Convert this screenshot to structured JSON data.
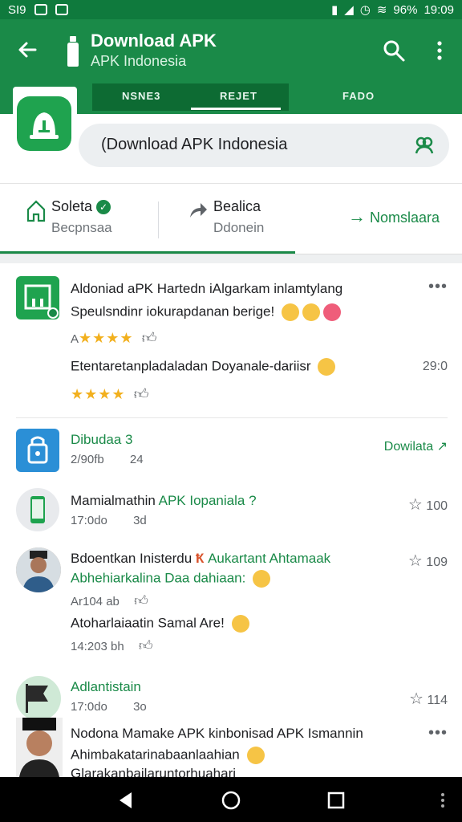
{
  "status": {
    "left_text": "SI9",
    "battery": "96%",
    "time": "19:09"
  },
  "header": {
    "title": "Download APK",
    "subtitle": "APK Indonesia"
  },
  "tabs": [
    {
      "label": "NSNE3"
    },
    {
      "label": "REJET"
    },
    {
      "label": "FADO"
    }
  ],
  "search": {
    "value": "(Download APK Indonesia"
  },
  "actions": {
    "left": {
      "title": "Soleta",
      "sub": "Becpnsaa"
    },
    "middle": {
      "title": "Bealica",
      "sub": "Ddonein"
    },
    "right": {
      "label": "Nomslaara"
    }
  },
  "items": [
    {
      "line1": "Aldoniad aPK Hartedn iAlgarkam inlamtylang",
      "line2": "Speulsndinr iokurapdanan berige!",
      "rating1": "★★★★",
      "rating_prefix": "A",
      "line3": "Etentaretanpladaladan Doyanale-dariisr",
      "time": "29:0",
      "rating2": "★★★★"
    },
    {
      "title": "Dibudaa 3",
      "meta": "2/90fb",
      "count": "24",
      "action": "Dowilata"
    },
    {
      "title_a": "Mamialmathin",
      "title_b": "APK Iopaniala ?",
      "meta": "17:0do",
      "count": "3d",
      "num": "100"
    },
    {
      "line1_a": "Bdoentkan Inisterdu",
      "line1_b": "Aukartant Ahtamaak",
      "line2": "Abhehiarkalina Daa dahiaan:",
      "meta": "Ar104 ab",
      "line3": "Atoharlaiaatin Samal Are!",
      "meta2": "14:203 bh",
      "num": "109"
    },
    {
      "title": "Adlantistain",
      "meta": "17:0do",
      "count": "3o",
      "num": "114"
    },
    {
      "line1": "Nodona Mamake APK kinbonisad APK Ismannin",
      "line2": "Ahimbakatarinabaanlaahian",
      "line3": "Glarakanbajlaruntorhuahari"
    }
  ],
  "colors": {
    "primary": "#1a8a48",
    "status": "#0f7a3d",
    "star": "#f2b01e"
  }
}
